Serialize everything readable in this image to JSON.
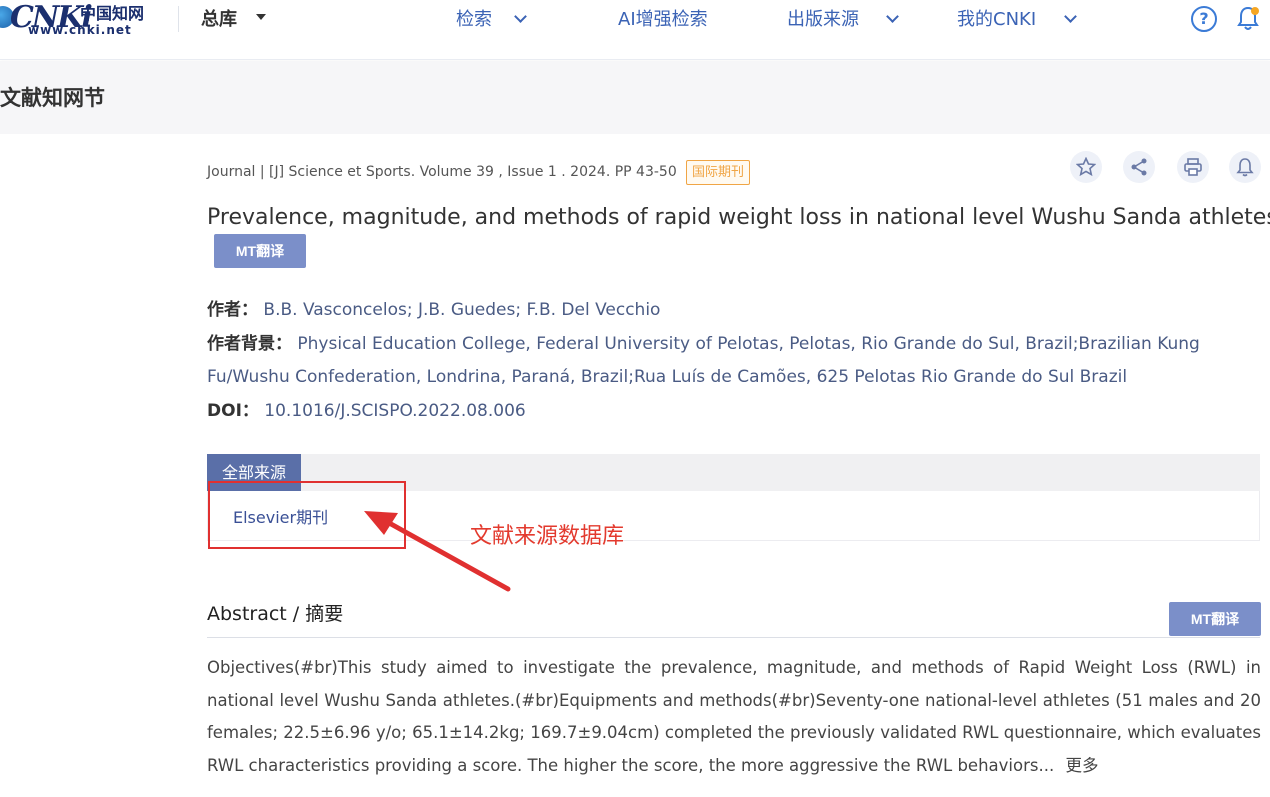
{
  "header": {
    "logo_text": "CNKi",
    "logo_cn": "中国知网",
    "logo_url": "www.cnki.net",
    "database_selector": "总库",
    "nav": [
      {
        "label": "检索",
        "has_dropdown": true
      },
      {
        "label": "AI增强检索",
        "has_dropdown": false
      },
      {
        "label": "出版来源",
        "has_dropdown": true
      },
      {
        "label": "我的CNKI",
        "has_dropdown": true
      }
    ],
    "icons": [
      "help-icon",
      "bell-icon"
    ]
  },
  "page": {
    "section_title": "文献知网节"
  },
  "article": {
    "journal_line": "Journal | [J] Science et Sports. Volume 39 , Issue 1 . 2024. PP 43-50",
    "badge": "国际期刊",
    "actions": [
      "star-icon",
      "share-icon",
      "print-icon",
      "bell-icon"
    ],
    "title": "Prevalence, magnitude, and methods of rapid weight loss in national level Wushu Sanda athletes",
    "mt_button": "MT翻译",
    "authors_label": "作者：",
    "authors": "B.B. Vasconcelos; J.B. Guedes; F.B. Del Vecchio",
    "affiliation_label": "作者背景：",
    "affiliation_line1": "Physical Education College, Federal University of Pelotas, Pelotas, Rio Grande do Sul, Brazil;Brazilian Kung",
    "affiliation_line2": "Fu/Wushu Confederation, Londrina, Paraná, Brazil;Rua Luís de Camões, 625 Pelotas Rio Grande do Sul Brazil",
    "doi_label": "DOI：",
    "doi": "10.1016/J.SCISPO.2022.08.006"
  },
  "sources": {
    "tab_label": "全部来源",
    "items": [
      "Elsevier期刊"
    ],
    "annotation": "文献来源数据库",
    "annotation_color": "#e33a2e"
  },
  "abstract": {
    "heading": "Abstract / 摘要",
    "mt_button": "MT翻译",
    "text": "Objectives(#br)This study aimed to investigate the prevalence, magnitude, and methods of Rapid Weight Loss (RWL) in national level Wushu Sanda athletes.(#br)Equipments and methods(#br)Seventy-one national-level athletes (51 males and 20 females; 22.5±6.96 y/o; 65.1±14.2kg; 169.7±9.04cm) completed the previously validated RWL questionnaire, which evaluates RWL characteristics providing a score. The higher the score, the more aggressive the RWL behaviors...",
    "more_label": "更多"
  },
  "colors": {
    "nav_blue": "#3b63b5",
    "source_tab": "#5a6fa8",
    "mt_button": "#7b8fc9",
    "badge_orange": "#f0a545",
    "highlight_red": "#e03030"
  }
}
